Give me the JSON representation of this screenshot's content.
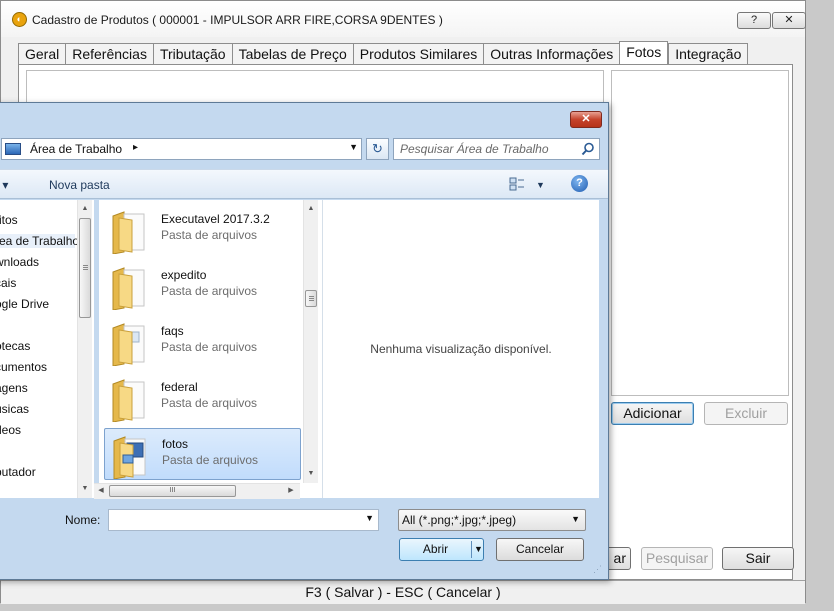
{
  "main_window": {
    "title": "Cadastro de Produtos ( 000001 - IMPULSOR ARR FIRE,CORSA 9DENTES )",
    "help_button": "?",
    "close_button": "✕",
    "tabs": [
      "Geral",
      "Referências",
      "Tributação",
      "Tabelas de Preço",
      "Produtos Similares",
      "Outras Informações",
      "Fotos",
      "Integração"
    ],
    "active_tab": "Fotos",
    "add_button": "Adicionar",
    "delete_button": "Excluir",
    "partial_button": "ar",
    "search_button": "Pesquisar",
    "exit_button": "Sair",
    "footer": "F3 ( Salvar )  -  ESC ( Cancelar )"
  },
  "open_dialog": {
    "close_button": "✕",
    "address": "Área de Trabalho",
    "address_arrow": "▸",
    "refresh_icon": "↻",
    "search_placeholder": "Pesquisar Área de Trabalho",
    "organize_label": "r ▾",
    "new_folder_label": "Nova pasta",
    "help_icon": "?",
    "nav_items": [
      "ritos",
      "rea de Trabalho",
      "wnloads",
      "cais",
      "ogle Drive",
      "otecas",
      "cumentos",
      "agens",
      "úsicas",
      "deos",
      "putador"
    ],
    "selected_nav": "rea de Trabalho",
    "files": [
      {
        "name": "Executavel 2017.3.2",
        "type": "Pasta de arquivos"
      },
      {
        "name": "expedito",
        "type": "Pasta de arquivos"
      },
      {
        "name": "faqs",
        "type": "Pasta de arquivos"
      },
      {
        "name": "federal",
        "type": "Pasta de arquivos"
      },
      {
        "name": "fotos",
        "type": "Pasta de arquivos"
      }
    ],
    "selected_file": "fotos",
    "preview_text": "Nenhuma visualização disponível.",
    "hscroll_grip": "III",
    "filename_label": "Nome:",
    "filename_value": "",
    "filetype": "All (*.png;*.jpg;*.jpeg)",
    "open_button": "Abrir",
    "cancel_button": "Cancelar"
  },
  "colors": {
    "dialog_frame": "#c4d9ef",
    "selection": "#c1dcfc",
    "folder": "#f2cf6a"
  },
  "icons": [
    "app-logo-icon",
    "drive-icon",
    "refresh-icon",
    "search-icon",
    "views-icon",
    "help-icon",
    "folder-icon"
  ]
}
